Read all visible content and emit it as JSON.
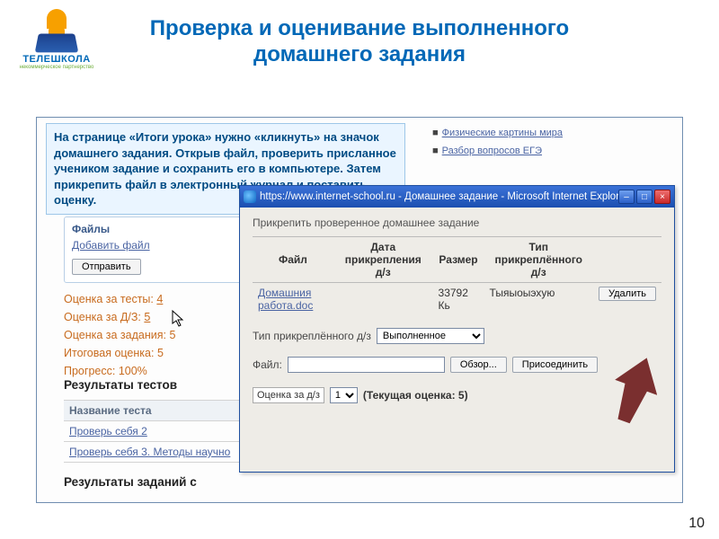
{
  "title": "Проверка и оценивание выполненного домашнего задания",
  "logo": {
    "brand": "ТЕЛЕШКОЛА",
    "sub": "некоммерческое партнерство"
  },
  "instruction": "На странице «Итоги урока» нужно «кликнуть» на значок домашнего задания. Открыв файл, проверить присланное учеником задание и сохранить его в компьютере. Затем прикрепить файл в электронный журнал и поставить оценку.",
  "rightLinks": [
    {
      "text": "Физические картины мира"
    },
    {
      "text": "Разбор вопросов ЕГЭ"
    }
  ],
  "filesBox": {
    "header": "Файлы",
    "addLink": "Добавить файл",
    "sendBtn": "Отправить"
  },
  "grades": {
    "tests_label": "Оценка за тесты:",
    "tests_val": "4",
    "hw_label": "Оценка за Д/З:",
    "hw_val": "5",
    "tasks_label": "Оценка за задания:",
    "tasks_val": "5",
    "final_label": "Итоговая оценка:",
    "final_val": "5",
    "progress_label": "Прогресс:",
    "progress_val": "100%"
  },
  "section1": "Результаты тестов",
  "testTable": {
    "header": "Название теста",
    "rows": [
      "Проверь себя 2",
      "Проверь себя 3. Методы научно"
    ]
  },
  "section2": "Результаты заданий с",
  "dialog": {
    "title": "https://www.internet-school.ru - Домашнее задание - Microsoft Internet Explorer",
    "caption": "Прикрепить проверенное домашнее задание",
    "cols": {
      "file": "Файл",
      "date": "Дата прикрепления д/з",
      "size": "Размер",
      "type": "Тип прикреплённого д/з"
    },
    "row": {
      "fileLink": "Домашния работа.doc",
      "date": "",
      "size": "33792 Кь",
      "type": "Тыяыоыэхую",
      "deleteBtn": "Удалить"
    },
    "typeLabel": "Тип прикреплённого д/з",
    "typeValue": "Выполненное",
    "fileLabel": "Файл:",
    "browseBtn": "Обзор...",
    "attachBtn": "Присоединить",
    "gradeBoxLabel": "Оценка за д/з",
    "gradeValue": "1",
    "currentGrade": "(Текущая оценка: 5)"
  },
  "pageNumber": "10"
}
